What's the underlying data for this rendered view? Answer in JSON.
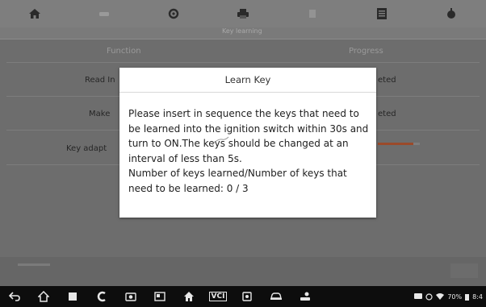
{
  "toolbar": {
    "items": [
      {
        "icon": "home-icon"
      },
      {
        "icon": "vehicle-icon"
      },
      {
        "icon": "settings-icon"
      },
      {
        "icon": "print-icon"
      },
      {
        "icon": "help-icon"
      },
      {
        "icon": "save-icon"
      },
      {
        "icon": "exit-icon"
      }
    ]
  },
  "subheader": {
    "center_tab": "Key learning"
  },
  "table": {
    "headers": {
      "function": "Function",
      "progress": "Progress"
    },
    "rows": [
      {
        "label": "Read In",
        "status": "eted"
      },
      {
        "label": "Make",
        "status": "eted"
      },
      {
        "label": "Key adapt",
        "status": ""
      }
    ],
    "progress_value": 0.85
  },
  "dialog": {
    "title": "Learn Key",
    "message": "Please insert in sequence the keys that need to be learned into the ignition switch within 30s and turn to ON.The keys should be changed at an interval of less than 5s.",
    "counter": "Number of keys learned/Number of keys that need to be learned: 0 / 3"
  },
  "navbar": {
    "items": [
      {
        "icon": "back-icon"
      },
      {
        "icon": "home-icon"
      },
      {
        "icon": "recent-apps-icon"
      },
      {
        "icon": "browser-icon"
      },
      {
        "icon": "camera-icon"
      },
      {
        "icon": "display-icon"
      },
      {
        "icon": "house-icon"
      },
      {
        "icon": "vci-icon",
        "label": "VCI"
      },
      {
        "icon": "vehicle-icon"
      },
      {
        "icon": "car-icon"
      },
      {
        "icon": "user-car-icon"
      }
    ],
    "status": {
      "battery": "70%",
      "time": "8:4"
    }
  }
}
